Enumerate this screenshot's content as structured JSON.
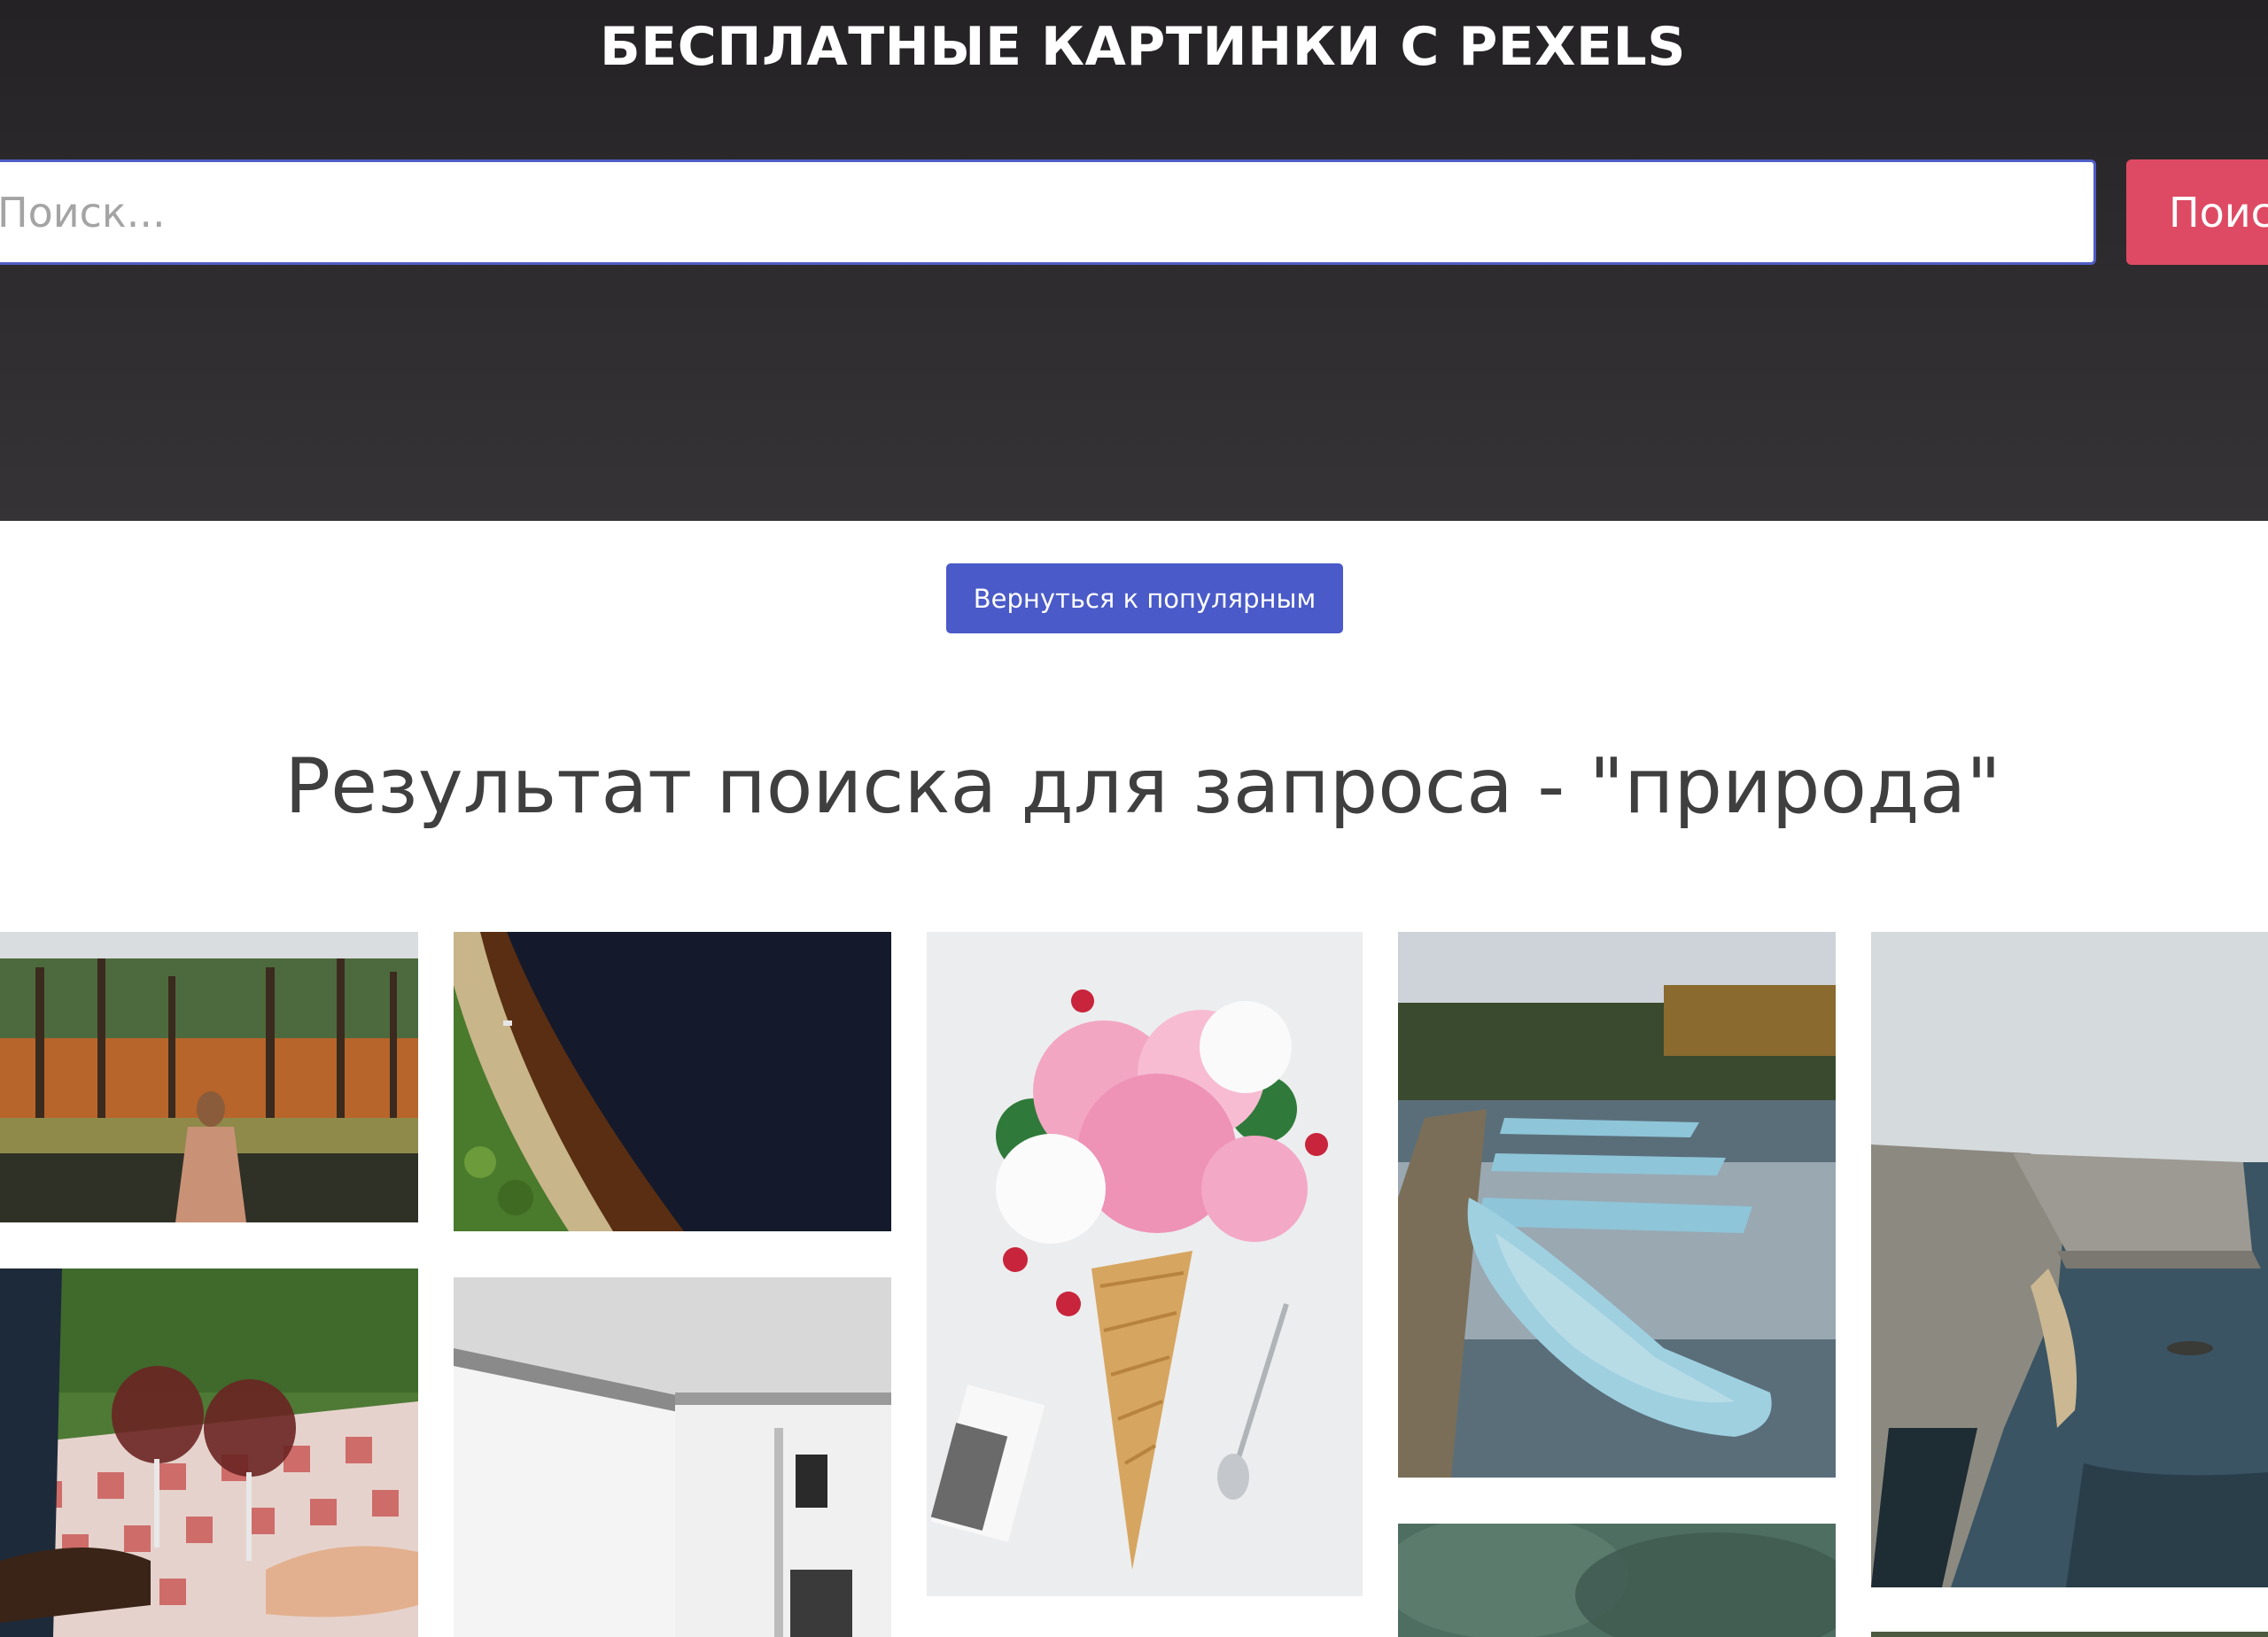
{
  "header": {
    "title": "БЕСПЛАТНЫЕ КАРТИНКИ С PEXELS",
    "search_placeholder": "Поиск...",
    "search_button": "Поиск"
  },
  "main": {
    "back_button": "Вернуться к популярным",
    "results_heading": "Результат поиска для запроса - \"природа\""
  },
  "gallery": {
    "photos": [
      {
        "subject": "woman-in-autumn-forest"
      },
      {
        "subject": "aerial-river-shore"
      },
      {
        "subject": "peony-ice-cream-cone"
      },
      {
        "subject": "blue-rowboats-on-lake"
      },
      {
        "subject": "sea-cliffs-coast"
      },
      {
        "subject": "wine-glasses-picnic"
      },
      {
        "subject": "white-building-bw"
      },
      {
        "subject": "blurred-green-nature"
      },
      {
        "subject": "green-landscape"
      }
    ]
  },
  "colors": {
    "header_bg": "#2a282a",
    "search_border": "#4f5ec7",
    "search_button": "#de4a63",
    "back_button": "#4a5ac8"
  }
}
